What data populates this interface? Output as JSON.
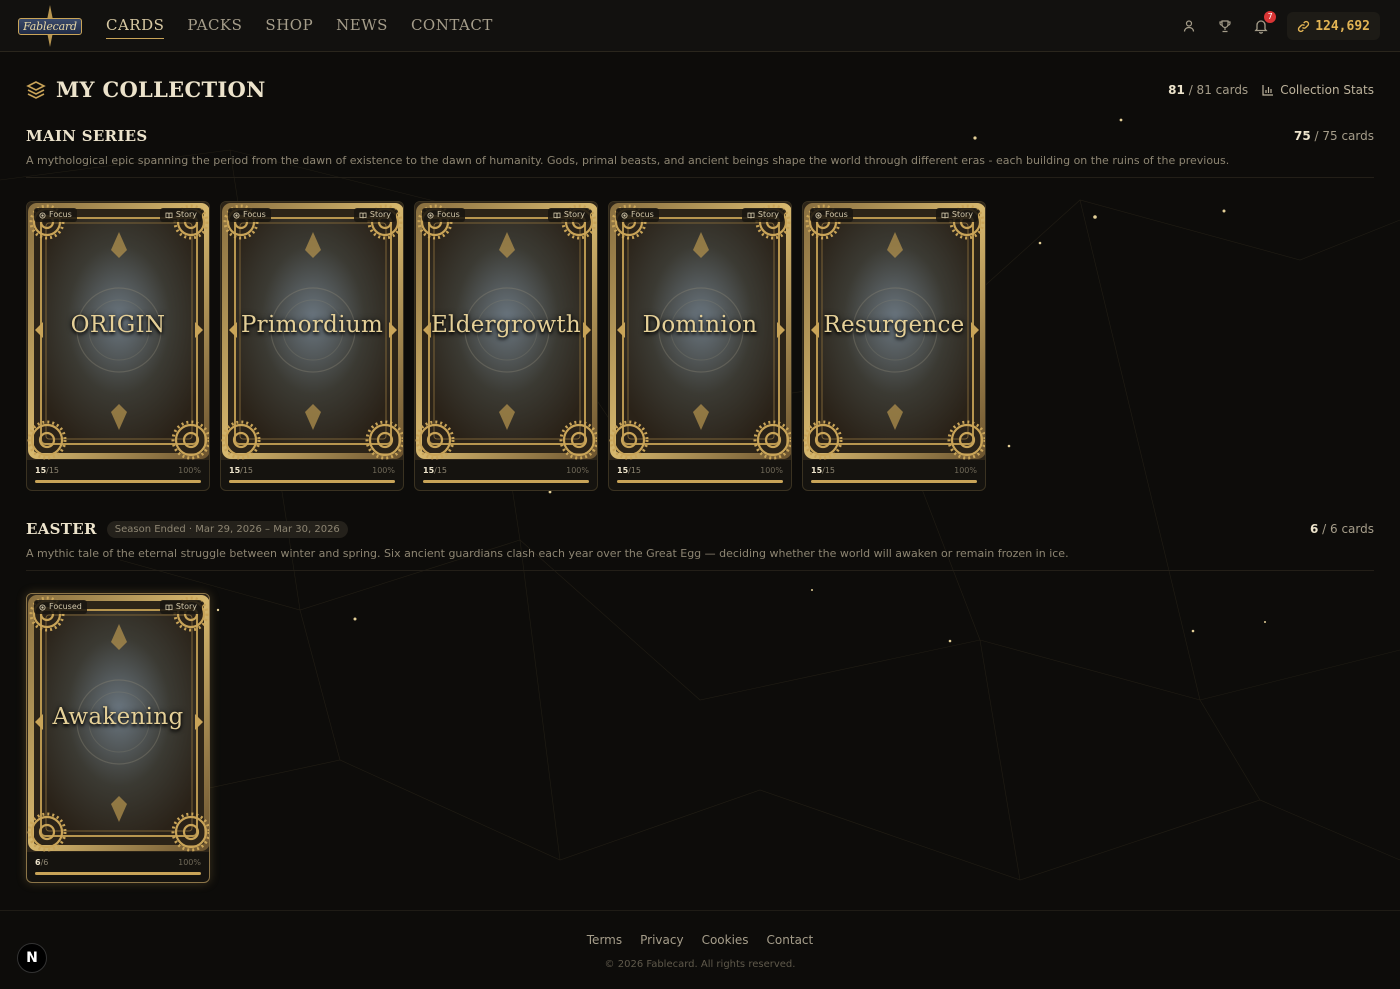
{
  "nav": {
    "logo_text": "Fablecard",
    "links": [
      {
        "label": "Cards"
      },
      {
        "label": "Packs"
      },
      {
        "label": "Shop"
      },
      {
        "label": "News"
      },
      {
        "label": "Contact"
      }
    ],
    "notifications_count": "7",
    "coins": "124,692"
  },
  "page": {
    "title": "My Collection",
    "owned": "81",
    "total_text": "/ 81 cards",
    "stats_label": "Collection Stats"
  },
  "sections": [
    {
      "title": "Main Series",
      "owned": "75",
      "total_text": "/ 75 cards",
      "description": "A mythological epic spanning the period from the dawn of existence to the dawn of humanity. Gods, primal beasts, and ancient beings shape the world through different eras - each building on the ruins of the previous.",
      "cards": [
        {
          "name": "ORIGIN",
          "tag_left": "Focus",
          "tag_right": "Story",
          "owned": "15",
          "total": "/15",
          "pct": "100%",
          "fill": 1.0
        },
        {
          "name": "Primordium",
          "tag_left": "Focus",
          "tag_right": "Story",
          "owned": "15",
          "total": "/15",
          "pct": "100%",
          "fill": 1.0
        },
        {
          "name": "Eldergrowth",
          "tag_left": "Focus",
          "tag_right": "Story",
          "owned": "15",
          "total": "/15",
          "pct": "100%",
          "fill": 1.0
        },
        {
          "name": "Dominion",
          "tag_left": "Focus",
          "tag_right": "Story",
          "owned": "15",
          "total": "/15",
          "pct": "100%",
          "fill": 1.0
        },
        {
          "name": "Resurgence",
          "tag_left": "Focus",
          "tag_right": "Story",
          "owned": "15",
          "total": "/15",
          "pct": "100%",
          "fill": 1.0
        }
      ]
    },
    {
      "title": "Easter",
      "season_status": "Season Ended · Mar 29, 2026 – Mar 30, 2026",
      "owned": "6",
      "total_text": "/ 6 cards",
      "description": "A mythic tale of the eternal struggle between winter and spring. Six ancient guardians clash each year over the Great Egg — deciding whether the world will awaken or remain frozen in ice.",
      "cards": [
        {
          "name": "Awakening",
          "tag_left": "Focused",
          "tag_right": "Story",
          "owned": "6",
          "total": "/6",
          "pct": "100%",
          "fill": 1.0
        }
      ]
    }
  ],
  "footer": {
    "links": [
      "Terms",
      "Privacy",
      "Cookies",
      "Contact"
    ],
    "copyright": "© 2026 Fablecard. All rights reserved."
  },
  "dev_badge": "N",
  "colors": {
    "accent": "#c9a458",
    "coin": "#e2b454",
    "badge": "#d93535",
    "background": "#0d0c0a"
  }
}
